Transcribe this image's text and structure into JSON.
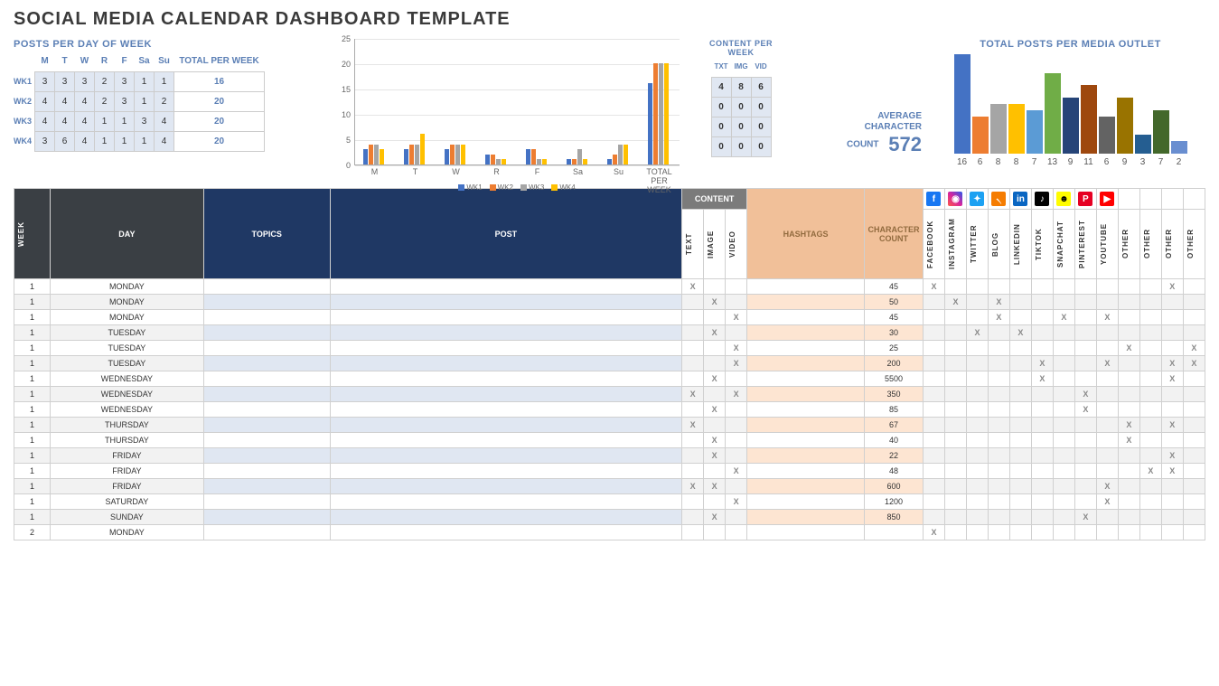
{
  "title": "SOCIAL MEDIA CALENDAR DASHBOARD TEMPLATE",
  "postsPerDay": {
    "label": "POSTS PER DAY OF WEEK",
    "totalLabel": "TOTAL PER WEEK",
    "days": [
      "M",
      "T",
      "W",
      "R",
      "F",
      "Sa",
      "Su"
    ],
    "weeks": [
      {
        "name": "WK1",
        "vals": [
          3,
          3,
          3,
          2,
          3,
          1,
          1
        ],
        "total": 16
      },
      {
        "name": "WK2",
        "vals": [
          4,
          4,
          4,
          2,
          3,
          1,
          2
        ],
        "total": 20
      },
      {
        "name": "WK3",
        "vals": [
          4,
          4,
          4,
          1,
          1,
          3,
          4
        ],
        "total": 20
      },
      {
        "name": "WK4",
        "vals": [
          3,
          6,
          4,
          1,
          1,
          1,
          4
        ],
        "total": 20
      }
    ]
  },
  "chart_data": {
    "type": "bar",
    "title": "",
    "xlabel": "",
    "ylabel": "",
    "ylim": [
      0,
      25
    ],
    "yticks": [
      0,
      5,
      10,
      15,
      20,
      25
    ],
    "categories": [
      "M",
      "T",
      "W",
      "R",
      "F",
      "Sa",
      "Su",
      "TOTAL PER WEEK"
    ],
    "series": [
      {
        "name": "WK1",
        "values": [
          3,
          3,
          3,
          2,
          3,
          1,
          1,
          16
        ]
      },
      {
        "name": "WK2",
        "values": [
          4,
          4,
          4,
          2,
          3,
          1,
          2,
          20
        ]
      },
      {
        "name": "WK3",
        "values": [
          4,
          4,
          4,
          1,
          1,
          3,
          4,
          20
        ]
      },
      {
        "name": "WK4",
        "values": [
          3,
          6,
          4,
          1,
          1,
          1,
          4,
          20
        ]
      }
    ]
  },
  "contentWeek": {
    "label": "CONTENT PER WEEK",
    "cols": [
      "TXT",
      "IMG",
      "VID"
    ],
    "rows": [
      [
        4,
        8,
        6
      ],
      [
        0,
        0,
        0
      ],
      [
        0,
        0,
        0
      ],
      [
        0,
        0,
        0
      ]
    ]
  },
  "avg": {
    "label1": "AVERAGE",
    "label2": "CHARACTER",
    "label3": "COUNT",
    "value": "572"
  },
  "mediaChart": {
    "label": "TOTAL POSTS PER MEDIA OUTLET",
    "values": [
      16,
      6,
      8,
      8,
      7,
      13,
      9,
      11,
      6,
      9,
      3,
      7,
      2
    ]
  },
  "headers": {
    "week": "WEEK",
    "day": "DAY",
    "topics": "TOPICS",
    "post": "POST",
    "content": "CONTENT",
    "text": "TEXT",
    "image": "IMAGE",
    "video": "VIDEO",
    "hashtags": "HASHTAGS",
    "cc": "CHARACTER COUNT",
    "media": [
      "FACEBOOK",
      "INSTAGRAM",
      "TWITTER",
      "BLOG",
      "LINKEDIN",
      "TIKTOK",
      "SNAPCHAT",
      "PINTEREST",
      "YOUTUBE",
      "OTHER",
      "OTHER",
      "OTHER",
      "OTHER"
    ]
  },
  "rows": [
    {
      "w": 1,
      "day": "MONDAY",
      "t": "X",
      "i": "",
      "v": "",
      "cc": 45,
      "m": [
        "X",
        "",
        "",
        "",
        "",
        "",
        "",
        "",
        "",
        "",
        "",
        "X",
        ""
      ]
    },
    {
      "w": 1,
      "day": "MONDAY",
      "t": "",
      "i": "X",
      "v": "",
      "cc": 50,
      "m": [
        "",
        "X",
        "",
        "X",
        "",
        "",
        "",
        "",
        "",
        "",
        "",
        "",
        ""
      ]
    },
    {
      "w": 1,
      "day": "MONDAY",
      "t": "",
      "i": "",
      "v": "X",
      "cc": 45,
      "m": [
        "",
        "",
        "",
        "X",
        "",
        "",
        "X",
        "",
        "X",
        "",
        "",
        "",
        ""
      ]
    },
    {
      "w": 1,
      "day": "TUESDAY",
      "t": "",
      "i": "X",
      "v": "",
      "cc": 30,
      "m": [
        "",
        "",
        "X",
        "",
        "X",
        "",
        "",
        "",
        "",
        "",
        "",
        "",
        ""
      ]
    },
    {
      "w": 1,
      "day": "TUESDAY",
      "t": "",
      "i": "",
      "v": "X",
      "cc": 25,
      "m": [
        "",
        "",
        "",
        "",
        "",
        "",
        "",
        "",
        "",
        "X",
        "",
        "",
        "X"
      ]
    },
    {
      "w": 1,
      "day": "TUESDAY",
      "t": "",
      "i": "",
      "v": "X",
      "cc": 200,
      "m": [
        "",
        "",
        "",
        "",
        "",
        "X",
        "",
        "",
        "X",
        "",
        "",
        "X",
        "X"
      ]
    },
    {
      "w": 1,
      "day": "WEDNESDAY",
      "t": "",
      "i": "X",
      "v": "",
      "cc": 5500,
      "m": [
        "",
        "",
        "",
        "",
        "",
        "X",
        "",
        "",
        "",
        "",
        "",
        "X",
        ""
      ]
    },
    {
      "w": 1,
      "day": "WEDNESDAY",
      "t": "X",
      "i": "",
      "v": "X",
      "cc": 350,
      "m": [
        "",
        "",
        "",
        "",
        "",
        "",
        "",
        "X",
        "",
        "",
        "",
        "",
        ""
      ]
    },
    {
      "w": 1,
      "day": "WEDNESDAY",
      "t": "",
      "i": "X",
      "v": "",
      "cc": 85,
      "m": [
        "",
        "",
        "",
        "",
        "",
        "",
        "",
        "X",
        "",
        "",
        "",
        "",
        ""
      ]
    },
    {
      "w": 1,
      "day": "THURSDAY",
      "t": "X",
      "i": "",
      "v": "",
      "cc": 67,
      "m": [
        "",
        "",
        "",
        "",
        "",
        "",
        "",
        "",
        "",
        "X",
        "",
        "X",
        ""
      ]
    },
    {
      "w": 1,
      "day": "THURSDAY",
      "t": "",
      "i": "X",
      "v": "",
      "cc": 40,
      "m": [
        "",
        "",
        "",
        "",
        "",
        "",
        "",
        "",
        "",
        "X",
        "",
        "",
        ""
      ]
    },
    {
      "w": 1,
      "day": "FRIDAY",
      "t": "",
      "i": "X",
      "v": "",
      "cc": 22,
      "m": [
        "",
        "",
        "",
        "",
        "",
        "",
        "",
        "",
        "",
        "",
        "",
        "X",
        ""
      ]
    },
    {
      "w": 1,
      "day": "FRIDAY",
      "t": "",
      "i": "",
      "v": "X",
      "cc": 48,
      "m": [
        "",
        "",
        "",
        "",
        "",
        "",
        "",
        "",
        "",
        "",
        "X",
        "X",
        ""
      ]
    },
    {
      "w": 1,
      "day": "FRIDAY",
      "t": "X",
      "i": "X",
      "v": "",
      "cc": 600,
      "m": [
        "",
        "",
        "",
        "",
        "",
        "",
        "",
        "",
        "X",
        "",
        "",
        "",
        ""
      ]
    },
    {
      "w": 1,
      "day": "SATURDAY",
      "t": "",
      "i": "",
      "v": "X",
      "cc": 1200,
      "m": [
        "",
        "",
        "",
        "",
        "",
        "",
        "",
        "",
        "X",
        "",
        "",
        "",
        ""
      ]
    },
    {
      "w": 1,
      "day": "SUNDAY",
      "t": "",
      "i": "X",
      "v": "",
      "cc": 850,
      "m": [
        "",
        "",
        "",
        "",
        "",
        "",
        "",
        "X",
        "",
        "",
        "",
        "",
        ""
      ]
    },
    {
      "w": 2,
      "day": "MONDAY",
      "t": "",
      "i": "",
      "v": "",
      "cc": "",
      "m": [
        "X",
        "",
        "",
        "",
        "",
        "",
        "",
        "",
        "",
        "",
        "",
        "",
        ""
      ]
    }
  ]
}
